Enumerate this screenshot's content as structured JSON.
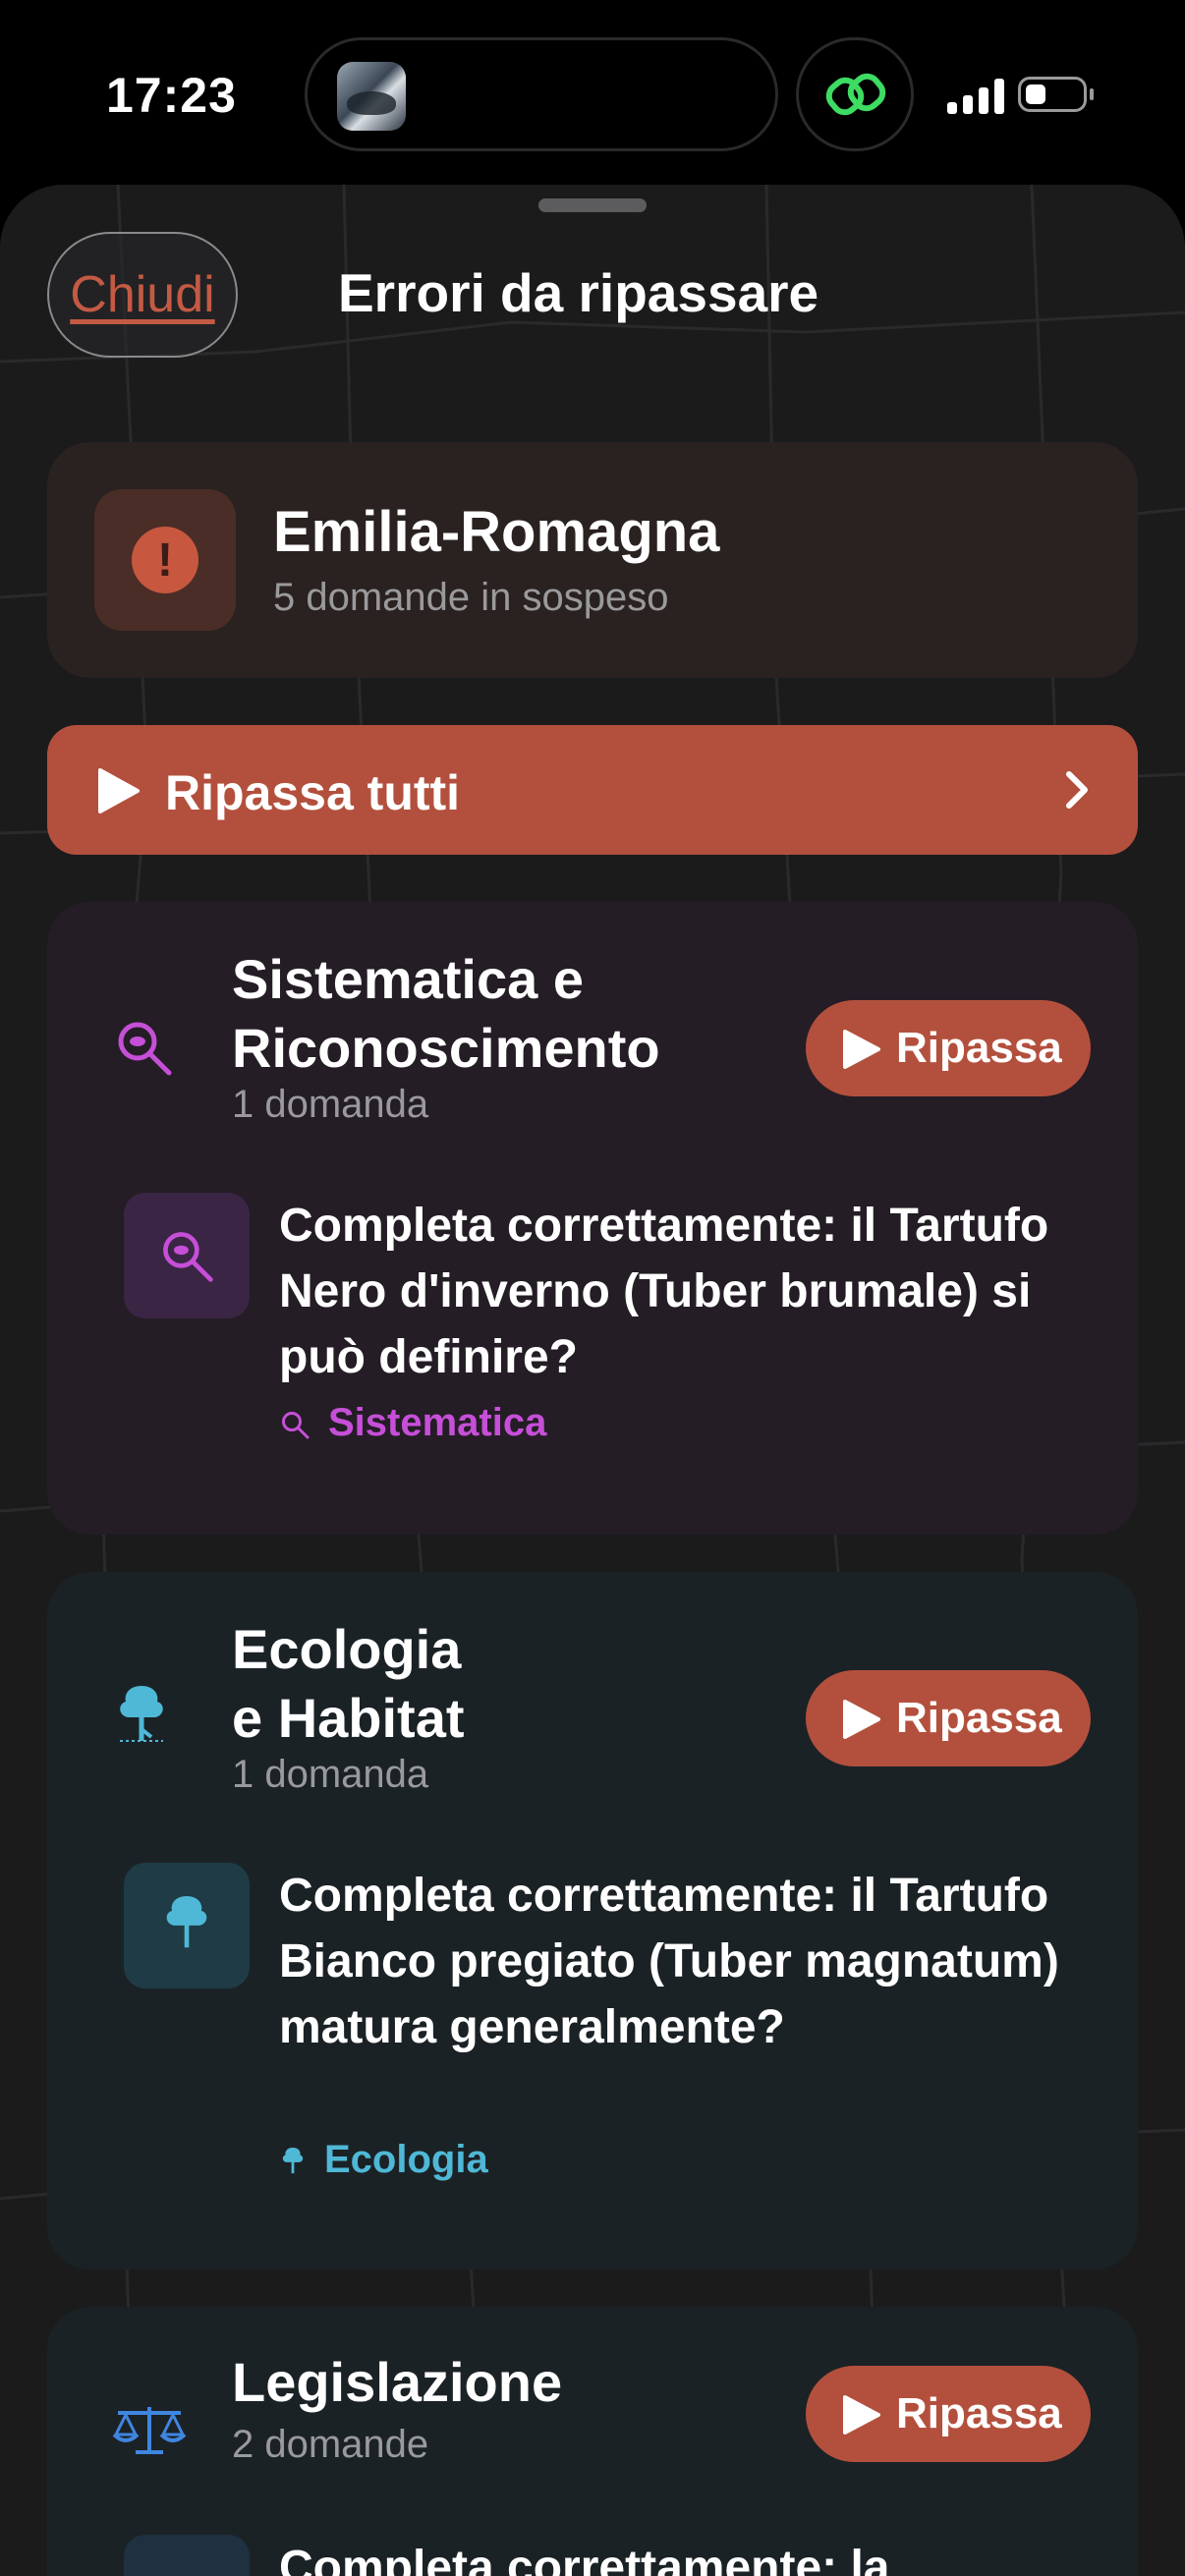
{
  "status_bar": {
    "time": "17:23"
  },
  "sheet": {
    "close_label": "Chiudi",
    "title": "Errori da ripassare"
  },
  "region": {
    "name": "Emilia-Romagna",
    "pending": "5 domande in sospeso",
    "icon": "exclamation-icon"
  },
  "review_all": {
    "label": "Ripassa tutti"
  },
  "categories": [
    {
      "title_line1": "Sistematica e",
      "title_line2": "Riconoscimento",
      "count": "1 domanda",
      "button": "Ripassa",
      "accent": "#c64fd8",
      "icon": "magnifier-icon",
      "question": "Completa correttamente: il Tartufo Nero d'inverno (Tuber brumale) si può definire?",
      "tag": "Sistematica"
    },
    {
      "title_line1": "Ecologia",
      "title_line2": "e Habitat",
      "count": "1 domanda",
      "button": "Ripassa",
      "accent": "#4fb8d6",
      "icon": "tree-icon",
      "question": "Completa correttamente: il Tartufo Bianco pregiato (Tuber magnatum) matura generalmente?",
      "tag": "Ecologia"
    },
    {
      "title_line1": "Legislazione",
      "count": "2 domande",
      "button": "Ripassa",
      "accent": "#3f86e0",
      "icon": "scales-icon",
      "question": "Completa correttamente: la"
    }
  ]
}
